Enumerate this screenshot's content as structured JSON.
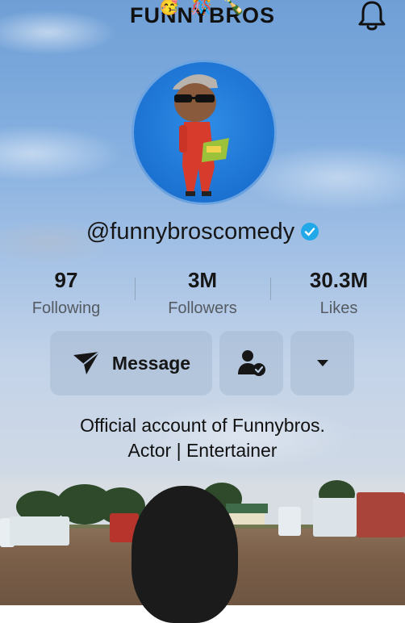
{
  "header": {
    "brand_text": "FUNNYBROS",
    "emojis": [
      "🥳",
      "🎊",
      "🍾"
    ],
    "bell_icon": "bell-icon"
  },
  "profile": {
    "handle": "@funnybroscomedy",
    "verified_color": "#20a8e8"
  },
  "stats": [
    {
      "value": "97",
      "label": "Following"
    },
    {
      "value": "3M",
      "label": "Followers"
    },
    {
      "value": "30.3M",
      "label": "Likes"
    }
  ],
  "actions": {
    "message_label": "Message",
    "message_icon": "send-icon",
    "follow_icon": "person-check-icon",
    "more_icon": "caret-down-icon"
  },
  "bio": {
    "line1": "Official account of Funnybros.",
    "line2": "Actor | Entertainer"
  }
}
